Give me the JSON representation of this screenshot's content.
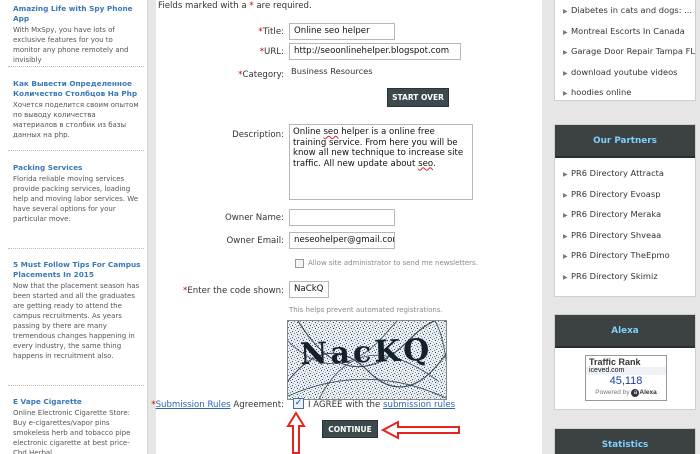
{
  "left_ads": [
    {
      "title": "Amazing Life with Spy Phone App",
      "body": "With MxSpy, you have lots of exclusive features for you to monitor any phone remotely and invisibly"
    },
    {
      "title": "Как Вывести Определенное Количество Столбцов На Php",
      "body": "Хочется поделится своим опытом по выводу количества материалов в столбик из базы данных на php."
    },
    {
      "title": "Packing Services",
      "body": "Florida reliable moving services provide packing services, loading help and moving labor services. We have several options for your particular move."
    },
    {
      "title": "5 Must Follow Tips For Campus Placements In 2015",
      "body": "Now that the placement season has been started and all the graduates are getting ready to attend the campus recruitments. As years passing by there are many tremendous changes happening in every industry, the same thing happens in recruitment also."
    },
    {
      "title": "E Vape Cigarette",
      "body": "Online Electronic Cigarette Store: Buy e-cigarettes/vapor pins smokeless herb and tobacco pipe electronic cigarette at best price- Cbd Herbal"
    }
  ],
  "form": {
    "note_prefix": "Fields marked with a",
    "note_star": "*",
    "note_suffix": "are required.",
    "title_label": "Title:",
    "title_value": "Online seo helper",
    "url_label": "URL:",
    "url_value": "http://seoonlinehelper.blogspot.com",
    "category_label": "Category:",
    "category_value": "Business Resources",
    "start_over": "START OVER",
    "description_label": "Description:",
    "description_pre": "Online ",
    "description_word1": "seo",
    "description_mid": " helper is a online free training service. From here you will be know all new technique to increase site traffic. All new update about ",
    "description_word2": "seo",
    "description_end": ".",
    "owner_name_label": "Owner Name:",
    "owner_name_value": "",
    "owner_email_label": "Owner Email:",
    "owner_email_value": "neseohelper@gmail.com",
    "newsletter_label": "Allow site administrator to send me newsletters.",
    "code_label": "Enter the code shown:",
    "code_value": "NaCkQ",
    "code_help": "This helps prevent automated registrations.",
    "captcha_text": "NacKQ",
    "rules_link": "Submission Rules",
    "agreement_label": "Agreement:",
    "agree_text": "I AGREE with the",
    "agree_link": "submission rules",
    "continue": "CONTINUE"
  },
  "right": {
    "top_links": [
      "Diabetes in cats and dogs: ...",
      "Montreal Escorts In Canada",
      "Garage Door Repair Tampa FL",
      "download youtube videos",
      "hoodies online"
    ],
    "partners_title": "Our Partners",
    "partners": [
      "PR6 Directory Attracta",
      "PR6 Directory Evoasp",
      "PR6 Directory Meraka",
      "PR6 Directory Shveaa",
      "PR6 Directory TheEpmo",
      "PR6 Directory Skimiz"
    ],
    "alexa_title": "Alexa",
    "alexa_rank_label": "Traffic Rank",
    "alexa_site": "iceved.com",
    "alexa_rank": "45,118",
    "alexa_powered": "Powered by",
    "alexa_brand": "Alexa",
    "stats_title": "Statistics"
  },
  "colors": {
    "accent": "#cc0000",
    "link": "#3a78b8",
    "dark_button": "#3d4a4d",
    "header_text": "#7fd0ff"
  }
}
